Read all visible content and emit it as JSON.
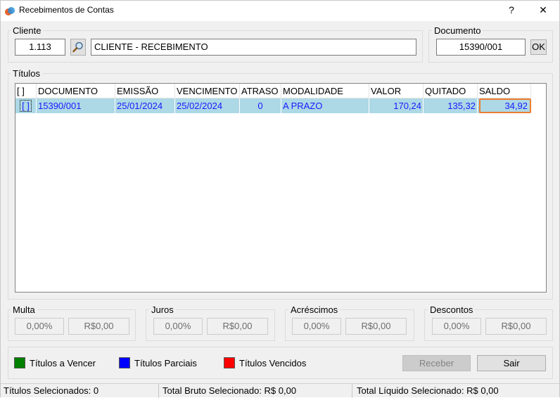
{
  "window": {
    "title": "Recebimentos de Contas",
    "help_label": "?",
    "close_label": "✕"
  },
  "cliente": {
    "label": "Cliente",
    "code": "1.113",
    "name": "CLIENTE - RECEBIMENTO"
  },
  "documento": {
    "label": "Documento",
    "value": "15390/001",
    "ok_label": "OK"
  },
  "titulos": {
    "label": "Títulos",
    "columns": [
      "[ ]",
      "DOCUMENTO",
      "EMISSÃO",
      "VENCIMENTO",
      "ATRASO",
      "MODALIDADE",
      "VALOR",
      "QUITADO",
      "SALDO"
    ],
    "rows": [
      {
        "check": "[ ]",
        "documento": "15390/001",
        "emissao": "25/01/2024",
        "vencimento": "25/02/2024",
        "atraso": "0",
        "modalidade": "A PRAZO",
        "valor": "170,24",
        "quitado": "135,32",
        "saldo": "34,92"
      }
    ]
  },
  "multa": {
    "label": "Multa",
    "percent": "0,00%",
    "amount": "R$0,00"
  },
  "juros": {
    "label": "Juros",
    "percent": "0,00%",
    "amount": "R$0,00"
  },
  "acrescimos": {
    "label": "Acréscimos",
    "percent": "0,00%",
    "amount": "R$0,00"
  },
  "descontos": {
    "label": "Descontos",
    "percent": "0,00%",
    "amount": "R$0,00"
  },
  "legend": [
    {
      "label": "Títulos a Vencer",
      "color": "#008000"
    },
    {
      "label": "Títulos Parciais",
      "color": "#0000ff"
    },
    {
      "label": "Títulos Vencidos",
      "color": "#ff0000"
    }
  ],
  "buttons": {
    "receber": "Receber",
    "sair": "Sair"
  },
  "status": {
    "selecionados": "Títulos Selecionados: 0",
    "bruto": "Total Bruto Selecionado: R$ 0,00",
    "liquido": "Total Líquido Selecionado: R$ 0,00"
  },
  "colors": {
    "row_selected": "#add8e6",
    "row_text": "#1a1aff",
    "highlight": "#ec7d31"
  }
}
